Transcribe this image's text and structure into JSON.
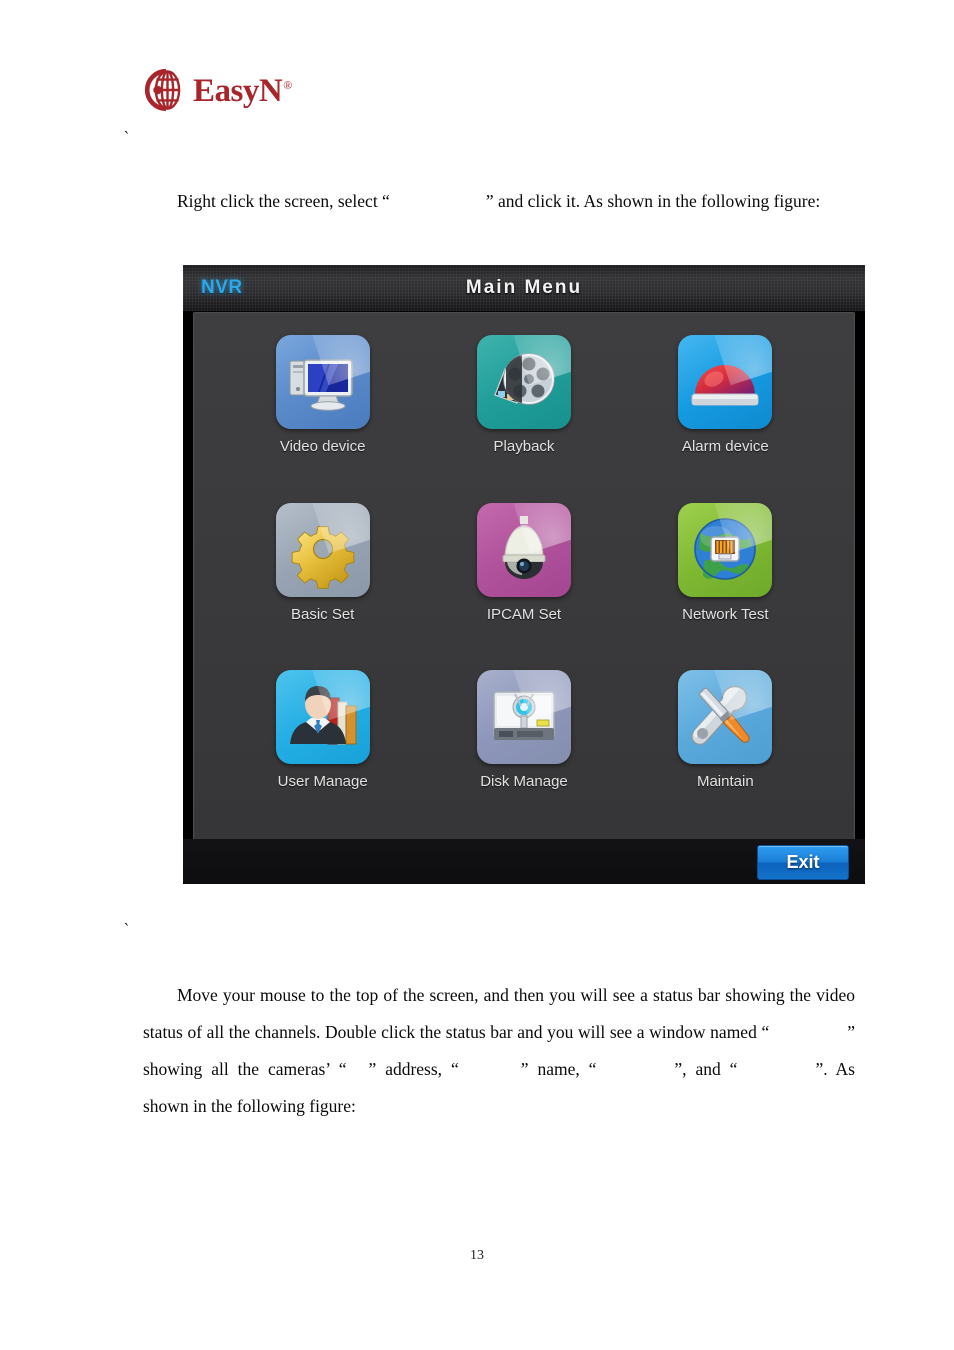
{
  "brand": {
    "name": "EasyN",
    "registered_mark": "®",
    "color": "#a8252b",
    "logo_icon": "globe-c-logo"
  },
  "marks": {
    "tick_top": "`",
    "tick_mid": "`"
  },
  "paragraphs": {
    "intro_before": "Right click the screen, select “",
    "intro_after": "” and click it. As shown in the following figure:",
    "body_line1": "Move your mouse to the top of the screen, and then you will see a status bar showing the video status of all the channels. Double click the status bar and you will see a window named “",
    "body_seg2": "” showing all the cameras’ “",
    "body_seg3": "” address, “",
    "body_seg4": "” name, “",
    "body_seg5": "”, and “",
    "body_seg6": "”. As shown in the following figure:"
  },
  "nvr": {
    "titlebar": {
      "logo": "NVR",
      "title": "Main Menu"
    },
    "menu_items": [
      {
        "label": "Video device",
        "icon": "monitor-pc-icon",
        "tile_class": "bg-video",
        "accent": "#5c8ccb"
      },
      {
        "label": "Playback",
        "icon": "film-reel-icon",
        "tile_class": "bg-play",
        "accent": "#219e9a"
      },
      {
        "label": "Alarm device",
        "icon": "alarm-dome-light-icon",
        "tile_class": "bg-alarm",
        "accent": "#179be2"
      },
      {
        "label": "Basic Set",
        "icon": "gear-icon",
        "tile_class": "bg-basic",
        "accent": "#98a4b3"
      },
      {
        "label": "IPCAM Set",
        "icon": "ptz-dome-camera-icon",
        "tile_class": "bg-ipcam",
        "accent": "#b0529c"
      },
      {
        "label": "Network Test",
        "icon": "globe-rj45-icon",
        "tile_class": "bg-network",
        "accent": "#7fb933"
      },
      {
        "label": "User Manage",
        "icon": "user-books-icon",
        "tile_class": "bg-user",
        "accent": "#23aee4"
      },
      {
        "label": "Disk Manage",
        "icon": "hard-disk-icon",
        "tile_class": "bg-disk",
        "accent": "#8e97bb"
      },
      {
        "label": "Maintain",
        "icon": "wrench-screwdriver-icon",
        "tile_class": "bg-maint",
        "accent": "#5aa9dc"
      }
    ],
    "footer": {
      "exit_label": "Exit"
    }
  },
  "page_number": "13"
}
